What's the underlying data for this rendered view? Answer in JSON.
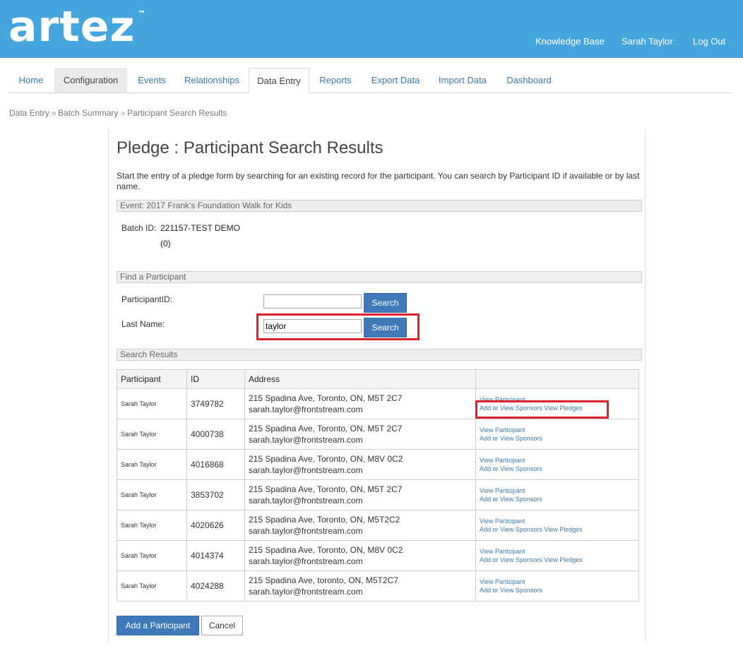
{
  "header": {
    "logo_text": "artez",
    "logo_tm": "™",
    "links": [
      "Knowledge Base",
      "Sarah Taylor",
      "Log Out"
    ]
  },
  "tabs": [
    "Home",
    "Configuration",
    "Events",
    "Relationships",
    "Data Entry",
    "Reports",
    "Export Data",
    "Import Data",
    "Dashboard"
  ],
  "breadcrumb": {
    "items": [
      "Data Entry",
      "Batch Summary",
      "Participant Search Results"
    ],
    "sep": "»"
  },
  "page": {
    "title": "Pledge : Participant Search Results",
    "intro": "Start the entry of a pledge form by searching for an existing record for the participant. You can search by Participant ID if available or by last name.",
    "event_header": "Event: 2017 Frank's Foundation Walk for Kids",
    "batch_label": "Batch ID:",
    "batch_value": "221157-TEST DEMO",
    "batch_count": "(0)",
    "find_header": "Find a Participant",
    "pid_label": "ParticipantID:",
    "pid_value": "",
    "lastname_label": "Last Name:",
    "lastname_value": "taylor",
    "search_label": "Search",
    "results_header": "Search Results"
  },
  "table": {
    "headers": [
      "Participant",
      "ID",
      "Address",
      ""
    ],
    "rows": [
      {
        "name": "Sarah Taylor",
        "id": "3749782",
        "addr": "215 Spadina Ave, Toronto, ON, M5T 2C7",
        "email": "sarah.taylor@frontstream.com",
        "view": "View Participant",
        "sponsors": "Add or View Sponsors",
        "pledges": "View Pledges"
      },
      {
        "name": "Sarah Taylor",
        "id": "4000738",
        "addr": "215 Spadina Ave, Toronto, ON, M5T 2C7",
        "email": "sarah.taylor@frontstream.com",
        "view": "View Participant",
        "sponsors": "Add or View Sponsors",
        "pledges": ""
      },
      {
        "name": "Sarah Taylor",
        "id": "4016868",
        "addr": "215 Spadina Ave, Toronto, ON, M8V 0C2",
        "email": "sarah.taylor@frontstream.com",
        "view": "View Participant",
        "sponsors": "Add or View Sponsors",
        "pledges": ""
      },
      {
        "name": "Sarah Taylor",
        "id": "3853702",
        "addr": "215 Spadina Ave, Toronto, ON, M5T 2C7",
        "email": "sarah.taylor@frontstream.com",
        "view": "View Participant",
        "sponsors": "Add or View Sponsors",
        "pledges": ""
      },
      {
        "name": "Sarah Taylor",
        "id": "4020626",
        "addr": "215 Spadina Ave, Toronto, ON, M5T2C2",
        "email": "sarah.taylor@frontstream.com",
        "view": "View Participant",
        "sponsors": "Add or View Sponsors",
        "pledges": "View Pledges"
      },
      {
        "name": "Sarah Taylor",
        "id": "4014374",
        "addr": "215 Spadina Ave, Toronto, ON, M8V 0C2",
        "email": "sarah.taylor@frontstream.com",
        "view": "View Participant",
        "sponsors": "Add or View Sponsors",
        "pledges": "View Pledges"
      },
      {
        "name": "Sarah Taylor",
        "id": "4024288",
        "addr": "215 Spadina Ave, toronto, ON, M5T2C7",
        "email": "sarah.taylor@frontstream.com",
        "view": "View Participant",
        "sponsors": "Add or View Sponsors",
        "pledges": ""
      }
    ]
  },
  "buttons": {
    "add": "Add a Participant",
    "cancel": "Cancel"
  },
  "colors": {
    "header_bg": "#45a5dd",
    "button_bg": "#3f79b9",
    "highlight_red": "#d9232a",
    "link": "#3b78a8"
  }
}
